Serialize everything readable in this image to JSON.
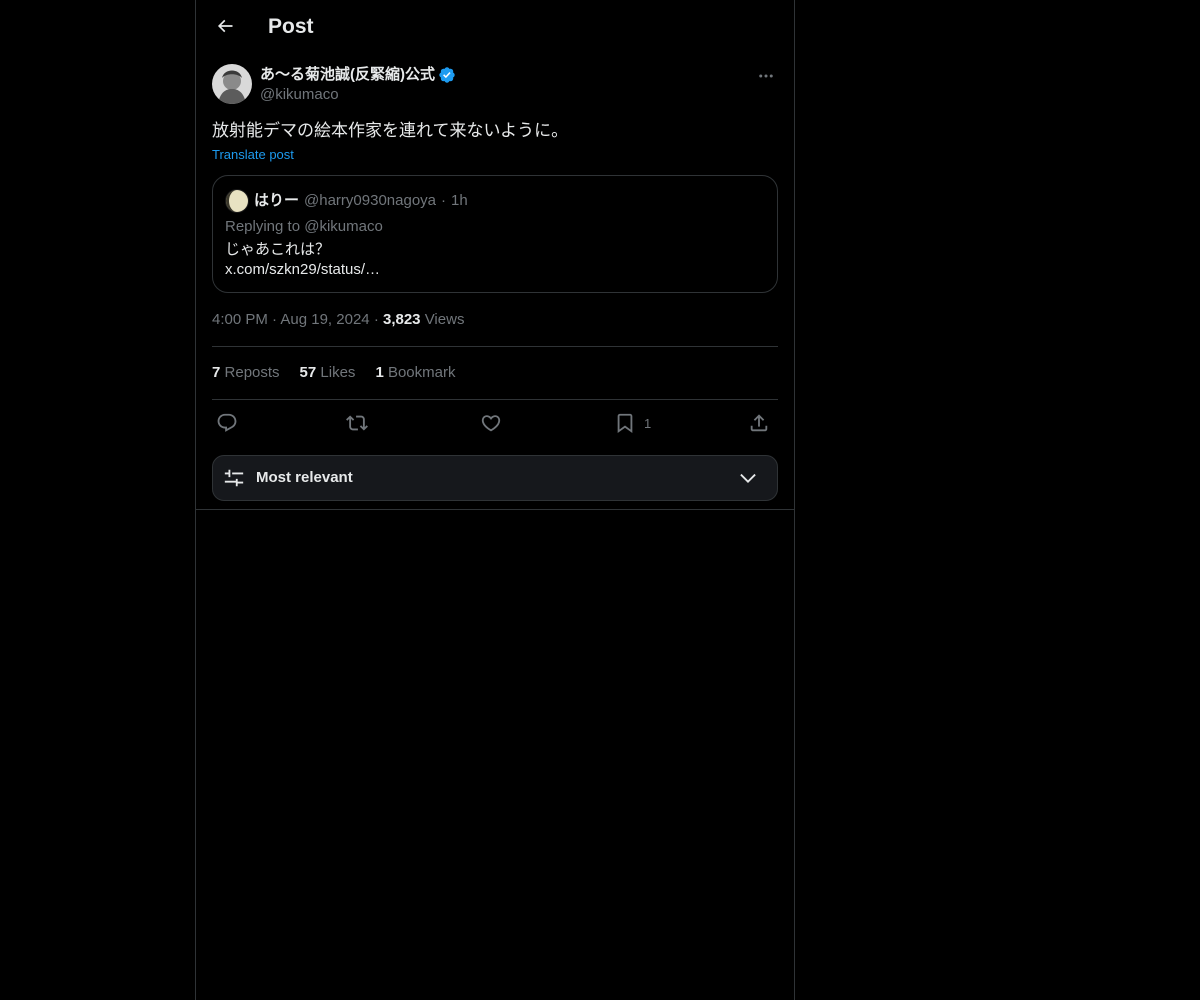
{
  "header": {
    "title": "Post",
    "back_icon": "arrow-left-icon"
  },
  "post": {
    "author_name": "あ〜る菊池誠(反緊縮)公式",
    "author_handle": "@kikumaco",
    "verified": true,
    "text": "放射能デマの絵本作家を連れて来ないように。",
    "translate_label": "Translate post",
    "time": "4:00 PM",
    "date": "Aug 19, 2024",
    "views_count": "3,823",
    "views_label": "Views"
  },
  "quote": {
    "name": "はりー",
    "handle": "@harry0930nagoya",
    "separator": "·",
    "age": "1h",
    "replying_to": "Replying to @kikumaco",
    "body_line1": "じゃあこれは？",
    "body_line2": "x.com/szkn29/status/…"
  },
  "stats": {
    "reposts_count": "7",
    "reposts_label": "Reposts",
    "likes_count": "57",
    "likes_label": "Likes",
    "bookmarks_count": "1",
    "bookmarks_label": "Bookmark"
  },
  "actions": {
    "reply_icon": "reply-icon",
    "repost_icon": "repost-icon",
    "like_icon": "heart-icon",
    "bookmark_icon": "bookmark-icon",
    "bookmark_count": "1",
    "share_icon": "share-icon"
  },
  "sort": {
    "label": "Most relevant"
  },
  "colors": {
    "background": "#000000",
    "text": "#e7e9ea",
    "secondary": "#71767b",
    "border": "#2f3336",
    "accent": "#1d9bf0"
  }
}
